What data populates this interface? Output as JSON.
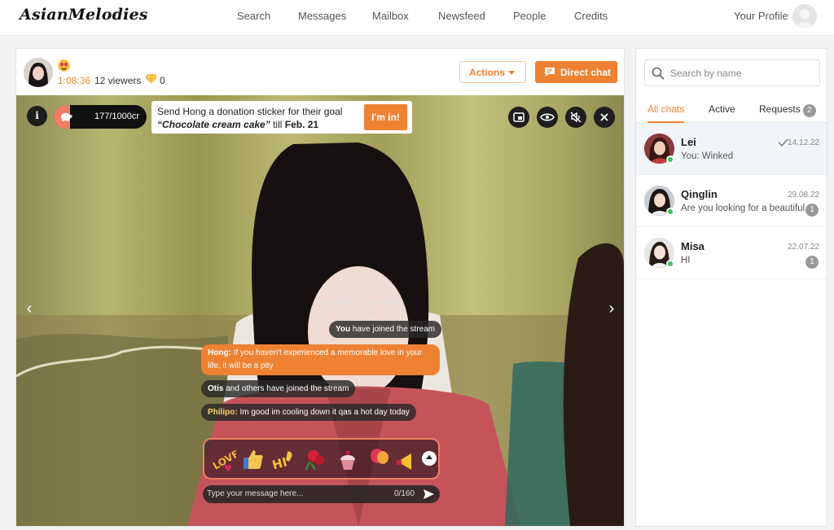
{
  "app": {
    "logo": "AsianMelodies"
  },
  "nav": {
    "items": [
      {
        "label": "Search"
      },
      {
        "label": "Messages"
      },
      {
        "label": "Mailbox"
      },
      {
        "label": "Newsfeed"
      },
      {
        "label": "People"
      },
      {
        "label": "Credits"
      }
    ],
    "profile_label": "Your Profile"
  },
  "stream": {
    "host_emoji": "smiling-face-with-heart-eyes",
    "timer": "1:08:36",
    "viewers": "12 viewers",
    "diamonds": "0",
    "actions_label": "Actions",
    "direct_chat_label": "Direct chat",
    "goal_progress_text": "177/1000cr",
    "goal_progress_fraction": 0.177,
    "donation": {
      "line1": "Send Hong a donation sticker for their goal",
      "goal_name": "“Chocolate cream cake”",
      "till_text": " till ",
      "goal_date": "Feb. 21",
      "button_label": "I'm in!"
    },
    "controls": [
      "picture-in-picture-icon",
      "eye-icon",
      "mute-icon",
      "close-icon"
    ],
    "chat": [
      {
        "name": "You",
        "text": " have joined the stream"
      },
      {
        "name": "Hong:",
        "text": " If you haven't experienced a memorable love in your life, it will be a pity"
      },
      {
        "name": "Otis",
        "text": " and others have joined the stream"
      },
      {
        "name": "Philipo:",
        "text": " Im good im cooling down it qas a hot day today"
      }
    ],
    "stickers": [
      "love-sticker",
      "thumbs-up-sticker",
      "hi-sticker",
      "rose-sticker",
      "cupcake-sticker",
      "balloon-sticker",
      "horn-sticker"
    ],
    "input": {
      "placeholder": "Type your message here...",
      "counter": "0/160"
    }
  },
  "sidebar": {
    "search_placeholder": "Search by name",
    "tabs": [
      {
        "label": "All chats"
      },
      {
        "label": "Active"
      },
      {
        "label": "Requests",
        "badge": "2"
      }
    ],
    "conversations": [
      {
        "name": "Lei",
        "preview": "You: Winked",
        "date": "14.12.22",
        "badge": ""
      },
      {
        "name": "Qinglin",
        "preview": "Are you looking for a beautiful",
        "date": "29.08.22",
        "badge": "1"
      },
      {
        "name": "Misa",
        "preview": "HI",
        "date": "22.07.22",
        "badge": "1"
      }
    ]
  },
  "colors": {
    "accent": "#ee8232",
    "online": "#3cc35a",
    "goal_fill": "#ee7f66"
  }
}
